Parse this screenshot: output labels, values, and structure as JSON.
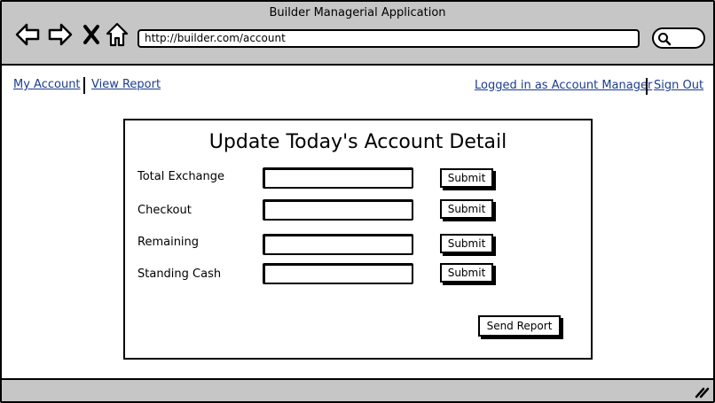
{
  "window": {
    "title": "Builder Managerial Application"
  },
  "browser": {
    "url": "http://builder.com/account",
    "icons": [
      "back-arrow-icon",
      "forward-arrow-icon",
      "close-icon",
      "home-icon",
      "search-icon"
    ]
  },
  "nav": {
    "my_account": "My Account",
    "view_report": "View Report",
    "logged_in": "Logged in as Account Manager",
    "sign_out": "Sign Out"
  },
  "form": {
    "title": "Update Today's Account Detail",
    "fields": [
      {
        "label": "Total Exchange",
        "value": "",
        "button": "Submit"
      },
      {
        "label": "Checkout",
        "value": "",
        "button": "Submit"
      },
      {
        "label": "Remaining",
        "value": "",
        "button": "Submit"
      },
      {
        "label": "Standing Cash",
        "value": "",
        "button": "Submit"
      }
    ],
    "send_report": "Send Report"
  },
  "colors": {
    "chrome": "#c6c6c6",
    "link": "#1a3d8f",
    "border": "#000000"
  }
}
